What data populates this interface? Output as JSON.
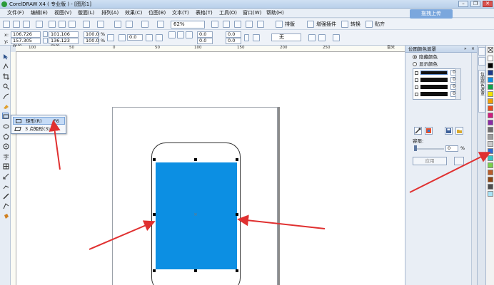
{
  "window": {
    "title": "CorelDRAW X4 ( 专业版 ) - [图形1]",
    "controls": [
      "–",
      "❐",
      "✕"
    ]
  },
  "menu": {
    "items": [
      "文件(F)",
      "编辑(E)",
      "视图(V)",
      "版面(L)",
      "排列(A)",
      "效果(C)",
      "位图(B)",
      "文本(T)",
      "表格(T)",
      "工具(O)",
      "窗口(W)",
      "帮助(H)"
    ],
    "cloud_button": "拖拽上传"
  },
  "toolbar": {
    "zoom": "62%",
    "layout_label": "排版",
    "plugin_label": "增强插件",
    "convert_label": "转换",
    "paste_label": "贴齐"
  },
  "property_bar": {
    "x_label": "x:",
    "x_value": "106.726 mm",
    "y_label": "y:",
    "y_value": "157.305 mm",
    "w_value": "101.106 mm",
    "h_value": "136.123 mm",
    "scale_w": "100.0",
    "scale_h": "100.0",
    "percent": "%",
    "angle_value": "0.0",
    "corner_values": [
      "0.0",
      "0.0",
      "0.0",
      "0.0"
    ],
    "line_width": "无"
  },
  "rulers": {
    "h_ticks": [
      "100",
      "50",
      "0",
      "50",
      "100",
      "150",
      "200",
      "250"
    ],
    "unit": "毫米"
  },
  "flyout": {
    "items": [
      {
        "label": "矩形(R)",
        "shortcut": "F6"
      },
      {
        "label": "3 点矩形(3)",
        "shortcut": ""
      }
    ]
  },
  "docker": {
    "title": "位图颜色遮罩",
    "hide_colors": "隐藏颜色",
    "show_colors": "显示颜色",
    "color_rows": [
      {
        "tolerance": "0"
      },
      {
        "tolerance": "0"
      },
      {
        "tolerance": "0"
      },
      {
        "tolerance": "0"
      }
    ],
    "tolerance_label": "容限:",
    "tolerance_value": "0",
    "tolerance_unit": "%",
    "apply_label": "应用",
    "side_tab_label": "位图颜色遮罩"
  },
  "palette": {
    "colors": [
      "#ffffff",
      "#000000",
      "#1a3a8a",
      "#0c8fe3",
      "#11a34a",
      "#f2e200",
      "#f0a000",
      "#e84c1f",
      "#d01c7e",
      "#8a2aa6",
      "#6b6b6b",
      "#9c9c9c",
      "#c8c8c8",
      "#2c6bd6",
      "#36c9c6",
      "#7bd14a",
      "#b95d2a",
      "#8b4513",
      "#4d4d4d",
      "#a8e4f7"
    ]
  },
  "colors": {
    "selected_rect_fill": "#0c8fe3",
    "annotation_arrow": "#e03030"
  }
}
